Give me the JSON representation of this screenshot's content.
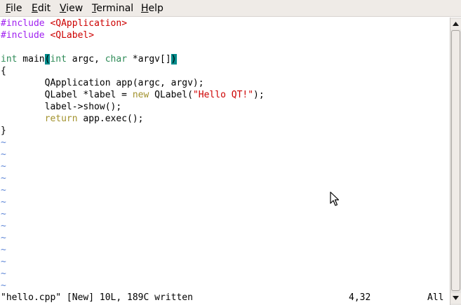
{
  "menu": {
    "file": {
      "mnemonic": "F",
      "rest": "ile"
    },
    "edit": {
      "mnemonic": "E",
      "rest": "dit"
    },
    "view": {
      "mnemonic": "V",
      "rest": "iew"
    },
    "terminal": {
      "mnemonic": "T",
      "rest": "erminal"
    },
    "help": {
      "mnemonic": "H",
      "rest": "elp"
    }
  },
  "editor": {
    "line1": {
      "directive": "#include ",
      "header": "<QApplication>"
    },
    "line2": {
      "directive": "#include ",
      "header": "<QLabel>"
    },
    "line4": {
      "type1": "int",
      "name": " main",
      "open_paren": "(",
      "type2": "int",
      "argc": " argc, ",
      "type3": "char",
      "argv": " *argv[]",
      "close_paren": ")"
    },
    "line5": "{",
    "line6": "        QApplication app(argc, argv);",
    "line7": {
      "pre": "        QLabel *label = ",
      "kw": "new",
      "mid": " QLabel(",
      "str": "\"Hello QT!\"",
      "post": ");"
    },
    "line8": "        label->show();",
    "line9": {
      "indent": "        ",
      "kw": "return",
      "rest": " app.exec();"
    },
    "line10": "}",
    "tilde": "~"
  },
  "status": {
    "message": "\"hello.cpp\" [New] 10L, 189C written",
    "position": "4,32",
    "scroll": "All"
  },
  "colors": {
    "preproc": "#a020f0",
    "string": "#cd0000",
    "type": "#2e8b57",
    "keyword": "#a2922d",
    "tilde": "#5f87d7",
    "match_highlight": "#008b8b"
  },
  "icons": {
    "scroll_up": "arrow-up-icon",
    "scroll_down": "arrow-down-icon",
    "pointer": "mouse-pointer-icon"
  }
}
